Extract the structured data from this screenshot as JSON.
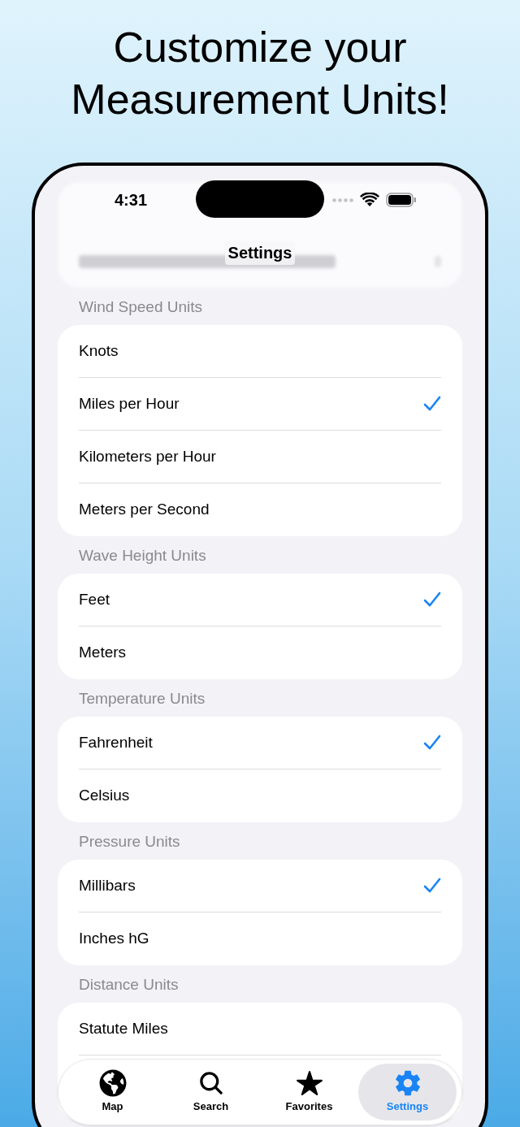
{
  "headline": "Customize your Measurement Units!",
  "status_bar": {
    "time": "4:31"
  },
  "nav": {
    "title": "Settings"
  },
  "sections": [
    {
      "title": "Wind Speed Units",
      "options": [
        {
          "label": "Knots",
          "selected": false
        },
        {
          "label": "Miles per Hour",
          "selected": true
        },
        {
          "label": "Kilometers per Hour",
          "selected": false
        },
        {
          "label": "Meters per Second",
          "selected": false
        }
      ]
    },
    {
      "title": "Wave Height Units",
      "options": [
        {
          "label": "Feet",
          "selected": true
        },
        {
          "label": "Meters",
          "selected": false
        }
      ]
    },
    {
      "title": "Temperature Units",
      "options": [
        {
          "label": "Fahrenheit",
          "selected": true
        },
        {
          "label": "Celsius",
          "selected": false
        }
      ]
    },
    {
      "title": "Pressure Units",
      "options": [
        {
          "label": "Millibars",
          "selected": true
        },
        {
          "label": "Inches hG",
          "selected": false
        }
      ]
    },
    {
      "title": "Distance Units",
      "options": [
        {
          "label": "Statute Miles",
          "selected": false
        }
      ]
    }
  ],
  "tabs": [
    {
      "kind": "map",
      "label": "Map",
      "selected": false
    },
    {
      "kind": "search",
      "label": "Search",
      "selected": false
    },
    {
      "kind": "favorites",
      "label": "Favorites",
      "selected": false
    },
    {
      "kind": "settings",
      "label": "Settings",
      "selected": true
    }
  ]
}
